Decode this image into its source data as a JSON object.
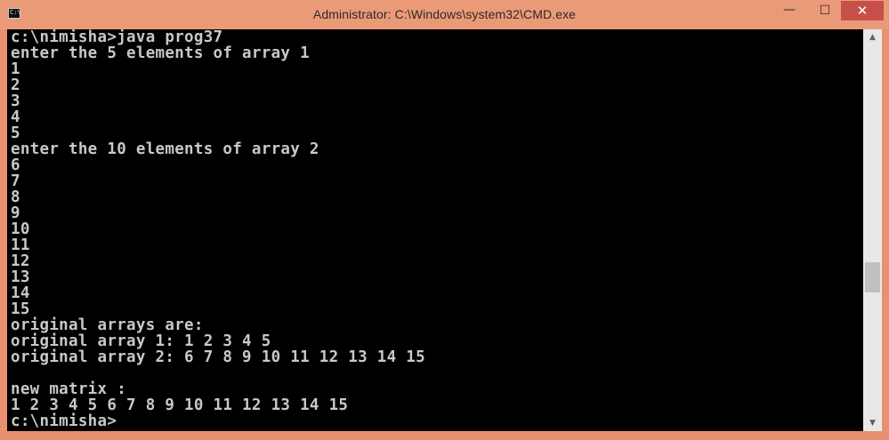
{
  "window": {
    "title": "Administrator: C:\\Windows\\system32\\CMD.exe",
    "icon_text": "C:\\",
    "minimize_glyph": "—",
    "maximize_glyph": "☐",
    "close_glyph": "✕"
  },
  "console": {
    "lines": [
      "c:\\nimisha>java prog37",
      "enter the 5 elements of array 1",
      "1",
      "2",
      "3",
      "4",
      "5",
      "enter the 10 elements of array 2",
      "6",
      "7",
      "8",
      "9",
      "10",
      "11",
      "12",
      "13",
      "14",
      "15",
      "original arrays are:",
      "original array 1: 1 2 3 4 5",
      "original array 2: 6 7 8 9 10 11 12 13 14 15",
      "",
      "new matrix :",
      "1 2 3 4 5 6 7 8 9 10 11 12 13 14 15",
      "c:\\nimisha>"
    ]
  },
  "scrollbar": {
    "up_glyph": "▲",
    "down_glyph": "▼",
    "position_fraction": 0.62
  },
  "colors": {
    "titlebar": "#eb9a78",
    "close_button": "#c7504a",
    "console_background": "#000000",
    "console_text": "#c8c8c8"
  },
  "icons": {
    "app": "console-icon",
    "minimize": "minimize-icon",
    "maximize": "maximize-icon",
    "close": "close-icon"
  }
}
